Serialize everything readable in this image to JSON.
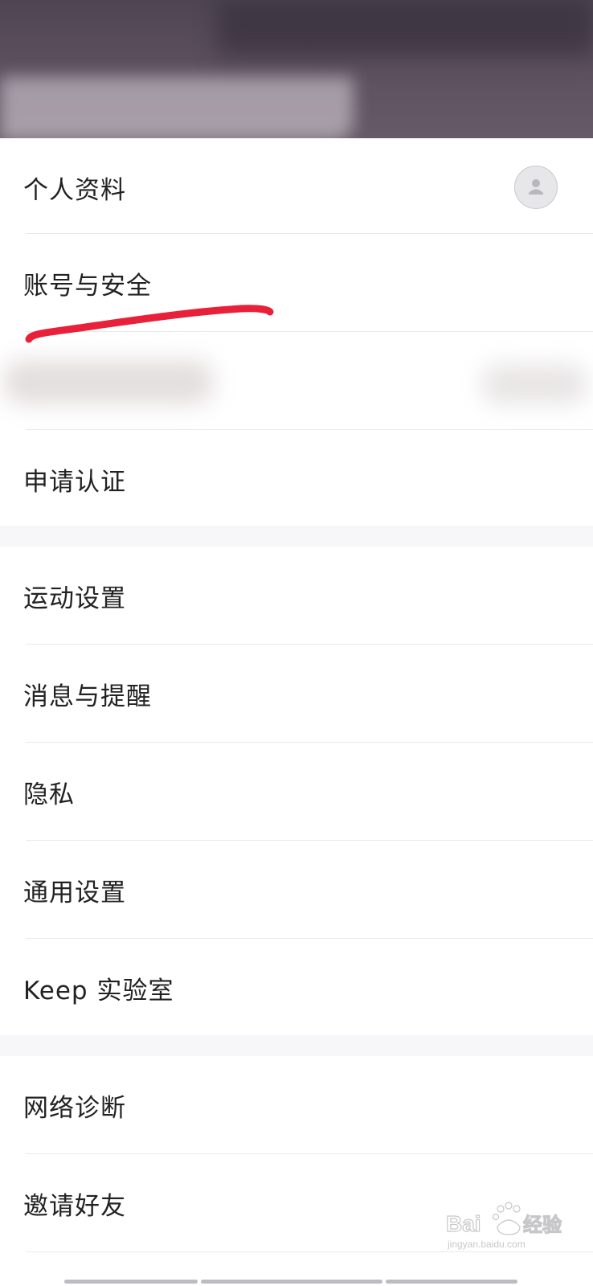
{
  "settings": {
    "profile_label": "个人资料",
    "account_security_label": "账号与安全",
    "apply_verification_label": "申请认证",
    "sport_settings_label": "运动设置",
    "messages_reminders_label": "消息与提醒",
    "privacy_label": "隐私",
    "general_settings_label": "通用设置",
    "keep_lab_label": "Keep 实验室",
    "network_diagnosis_label": "网络诊断",
    "invite_friends_label": "邀请好友"
  },
  "icons": {
    "avatar": "user-avatar-placeholder-icon"
  },
  "watermark": {
    "text": "Baidu经验",
    "subtext": "jingyan.baidu.com"
  },
  "colors": {
    "banner": "#5b4f5e",
    "annotation_stroke": "#e8203a",
    "divider": "#e9e9ec",
    "section_gap": "#f7f7f9"
  }
}
